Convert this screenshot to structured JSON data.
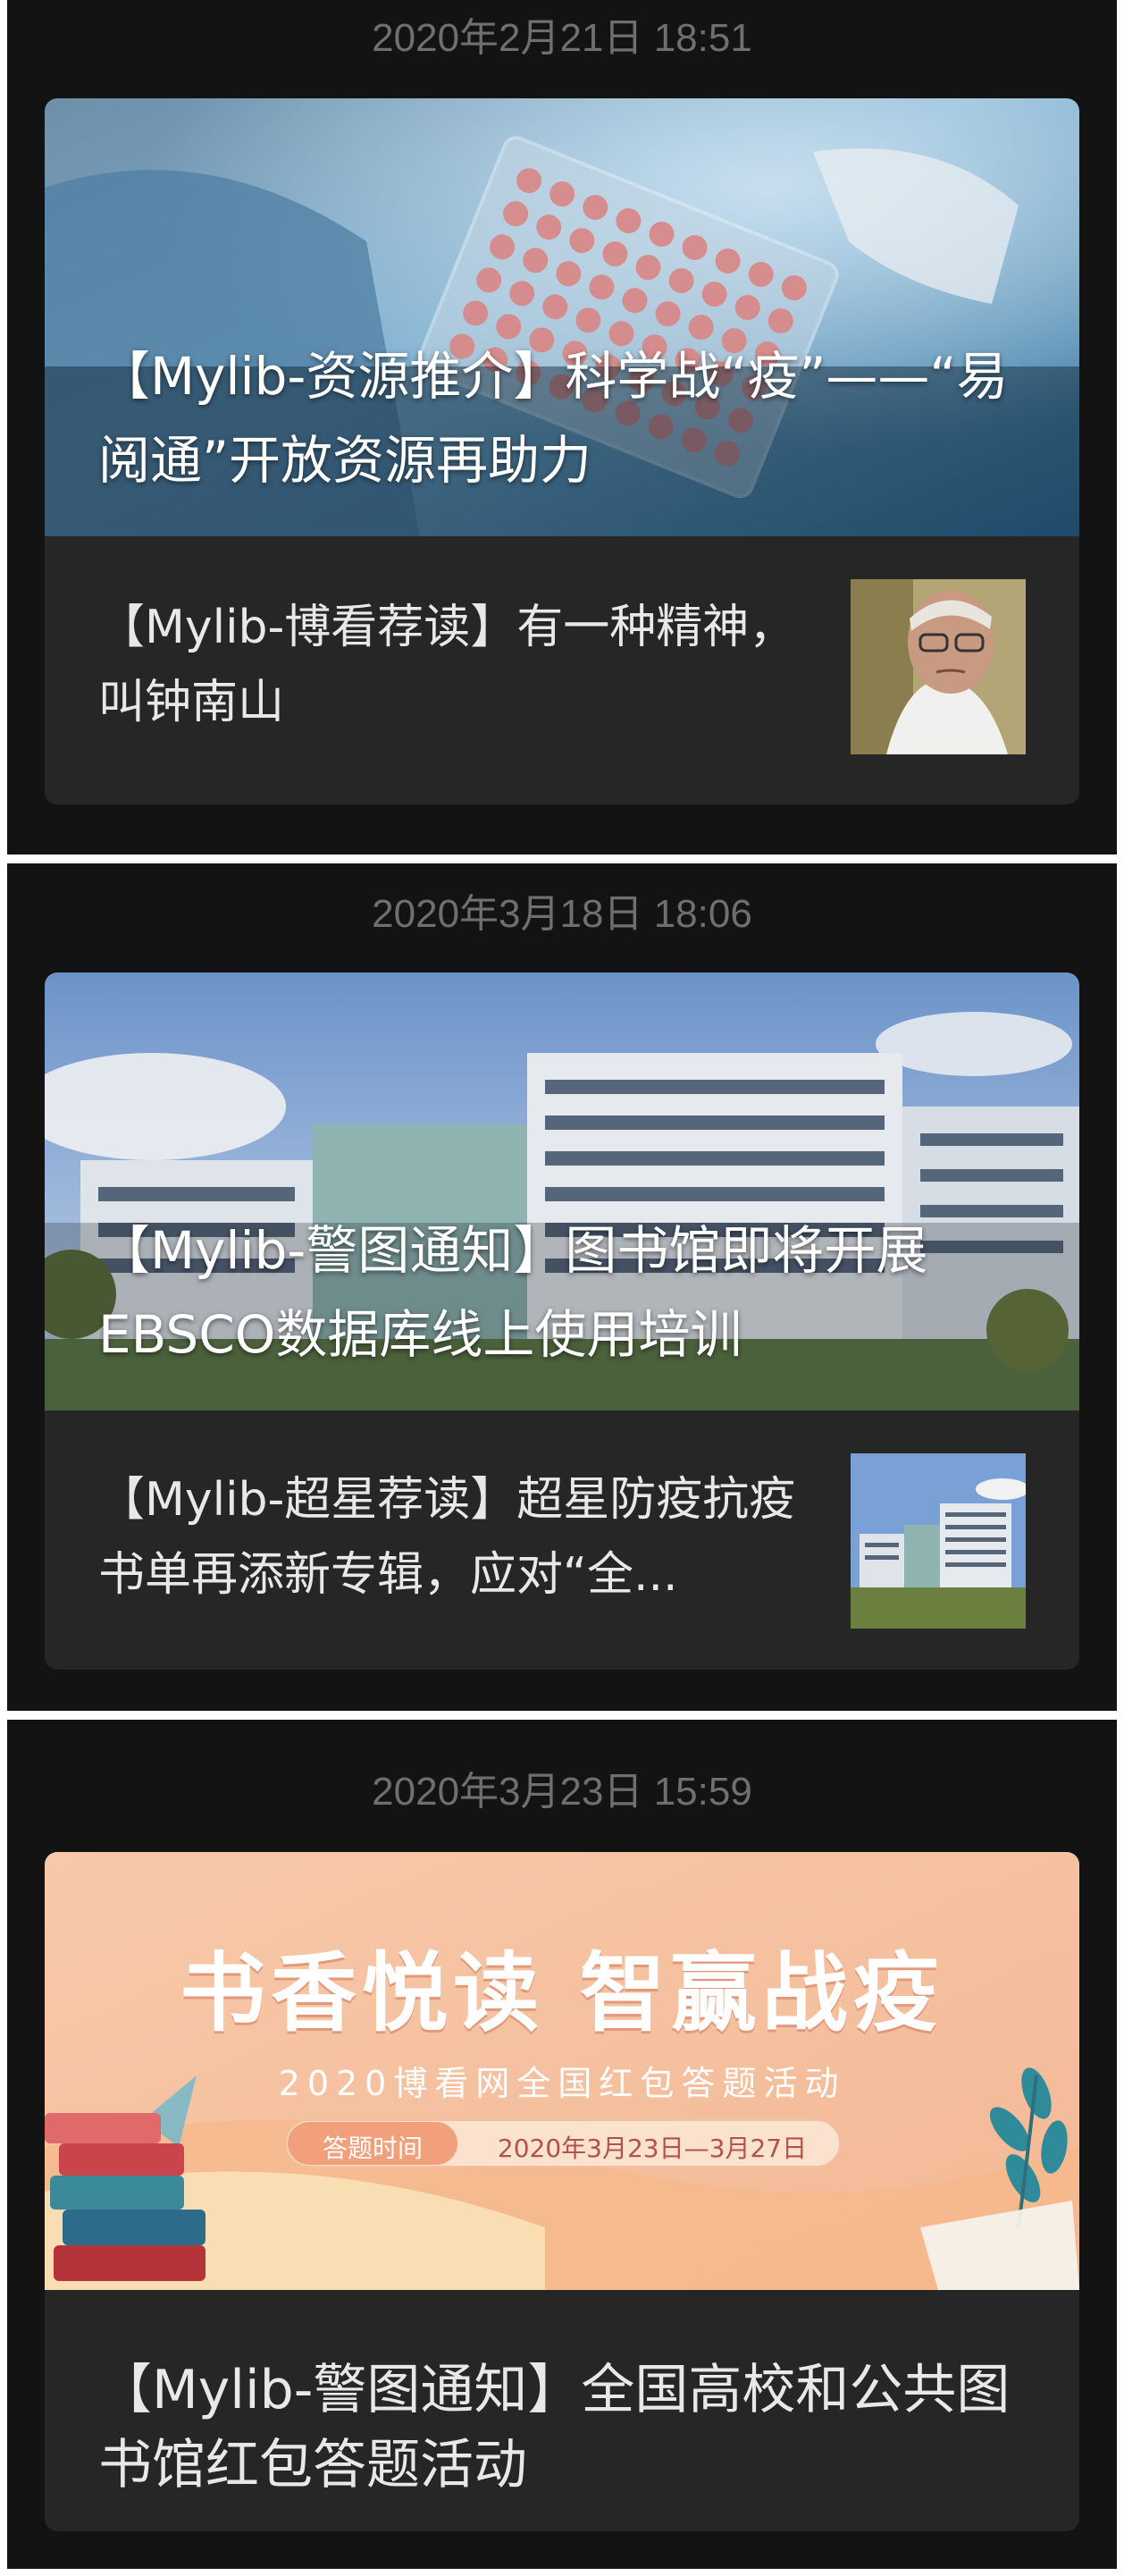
{
  "feed": [
    {
      "timestamp": "2020年2月21日 18:51",
      "main_title": "【Mylib-资源推介】科学战“疫”——“易阅通”开放资源再助力",
      "sub_title": "【Mylib-博看荐读】有一种精神，叫钟南山",
      "cover_icon": "lab-plate-image",
      "thumb_icon": "portrait-image"
    },
    {
      "timestamp": "2020年3月18日 18:06",
      "main_title": "【Mylib-警图通知】图书馆即将开展EBSCO数据库线上使用培训",
      "sub_title": "【Mylib-超星荐读】超星防疫抗疫书单再添新专辑，应对“全...",
      "cover_icon": "library-building-image",
      "thumb_icon": "library-building-image"
    },
    {
      "timestamp": "2020年3月23日 15:59",
      "banner": {
        "headline": "书香悦读 智赢战疫",
        "subheadline": "2020博看网全国红包答题活动",
        "tag_label": "答题时间",
        "tag_value": "2020年3月23日—3月27日"
      },
      "main_title": "【Mylib-警图通知】全国高校和公共图书馆红包答题活动",
      "cover_icon": "books-banner-image"
    }
  ],
  "colors": {
    "page_bg": "#131313",
    "card_bg": "#262626",
    "timestamp": "#6f6f6f",
    "text": "#e8e8e8",
    "banner_bg": "#f5c3a6"
  }
}
